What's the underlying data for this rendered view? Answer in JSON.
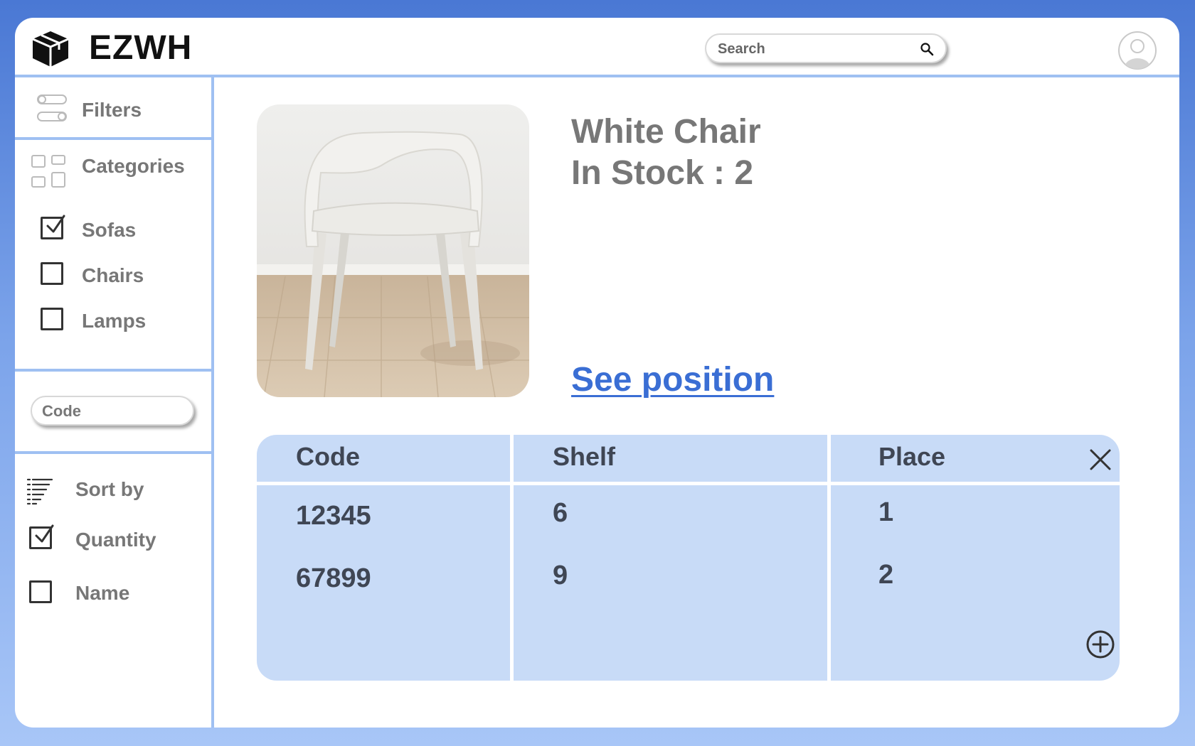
{
  "app": {
    "brand": "EZWH"
  },
  "header": {
    "search_placeholder": "Search"
  },
  "sidebar": {
    "filters_label": "Filters",
    "categories_label": "Categories",
    "categories": [
      {
        "label": "Sofas",
        "checked": true
      },
      {
        "label": "Chairs",
        "checked": false
      },
      {
        "label": "Lamps",
        "checked": false
      }
    ],
    "code_placeholder": "Code",
    "sort_label": "Sort by",
    "sort_options": [
      {
        "label": "Quantity",
        "checked": true
      },
      {
        "label": "Name",
        "checked": false
      }
    ]
  },
  "product": {
    "name": "White Chair",
    "stock_text": "In Stock : 2",
    "see_position_link": "See position"
  },
  "table": {
    "headers": [
      "Code",
      "Shelf",
      "Place"
    ],
    "rows": [
      [
        "12345",
        "6",
        "1"
      ],
      [
        "67899",
        "9",
        "2"
      ]
    ]
  },
  "colors": {
    "accent": "#3a6ed4",
    "divider": "#9fc0f2",
    "table_bg": "#c8dbf7"
  }
}
